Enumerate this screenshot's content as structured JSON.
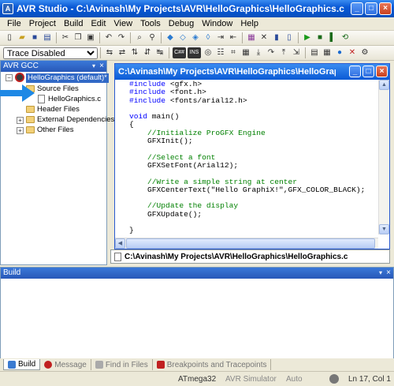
{
  "window": {
    "title": "AVR Studio - C:\\Avinash\\My Projects\\AVR\\HelloGraphics\\HelloGraphics.c",
    "app_icon": "avr-icon"
  },
  "menu": [
    "File",
    "Project",
    "Build",
    "Edit",
    "View",
    "Tools",
    "Debug",
    "Window",
    "Help"
  ],
  "toolbar2": {
    "trace_select_value": "Trace Disabled"
  },
  "left_panel": {
    "header": "AVR GCC",
    "tree": {
      "root": "HelloGraphics (default)*",
      "items": [
        "Source Files",
        "HelloGraphics.c",
        "Header Files",
        "External Dependencies",
        "Other Files"
      ]
    }
  },
  "editor": {
    "title": "C:\\Avinash\\My Projects\\AVR\\HelloGraphics\\HelloGraphics.c",
    "lines": [
      {
        "kw": "#include",
        "rest": " <gfx.h>"
      },
      {
        "kw": "#include",
        "rest": " <font.h>"
      },
      {
        "kw": "#include",
        "rest": " <fonts/arial12.h>"
      },
      {
        "kw": "",
        "rest": ""
      },
      {
        "kw": "void",
        "rest": " main()"
      },
      {
        "kw": "",
        "rest": "{"
      },
      {
        "comment": "    //Initialize ProGFX Engine"
      },
      {
        "kw": "",
        "rest": "    GFXInit();"
      },
      {
        "kw": "",
        "rest": ""
      },
      {
        "comment": "    //Select a font"
      },
      {
        "kw": "",
        "rest": "    GFXSetFont(Arial12);"
      },
      {
        "kw": "",
        "rest": ""
      },
      {
        "comment": "    //Write a simple string at center"
      },
      {
        "kw": "",
        "rest": "    GFXCenterText(\"Hello GraphiX!\",GFX_COLOR_BLACK);"
      },
      {
        "kw": "",
        "rest": ""
      },
      {
        "comment": "    //Update the display"
      },
      {
        "kw": "",
        "rest": "    GFXUpdate();"
      },
      {
        "kw": "",
        "rest": ""
      },
      {
        "kw": "",
        "rest": "}"
      }
    ]
  },
  "file_tab": {
    "label": "C:\\Avinash\\My Projects\\AVR\\HelloGraphics\\HelloGraphics.c"
  },
  "build_panel": {
    "header": "Build"
  },
  "bottom_tabs": [
    "Build",
    "Message",
    "Find in Files",
    "Breakpoints and Tracepoints"
  ],
  "status": {
    "device": "ATmega32",
    "tool": "AVR Simulator",
    "mode": "Auto",
    "position": "Ln 17, Col 1"
  },
  "colors": {
    "keyword": "#0000ff",
    "comment": "#008000",
    "title_bar": "#0a5ad6",
    "arrow": "#1e88e5"
  }
}
